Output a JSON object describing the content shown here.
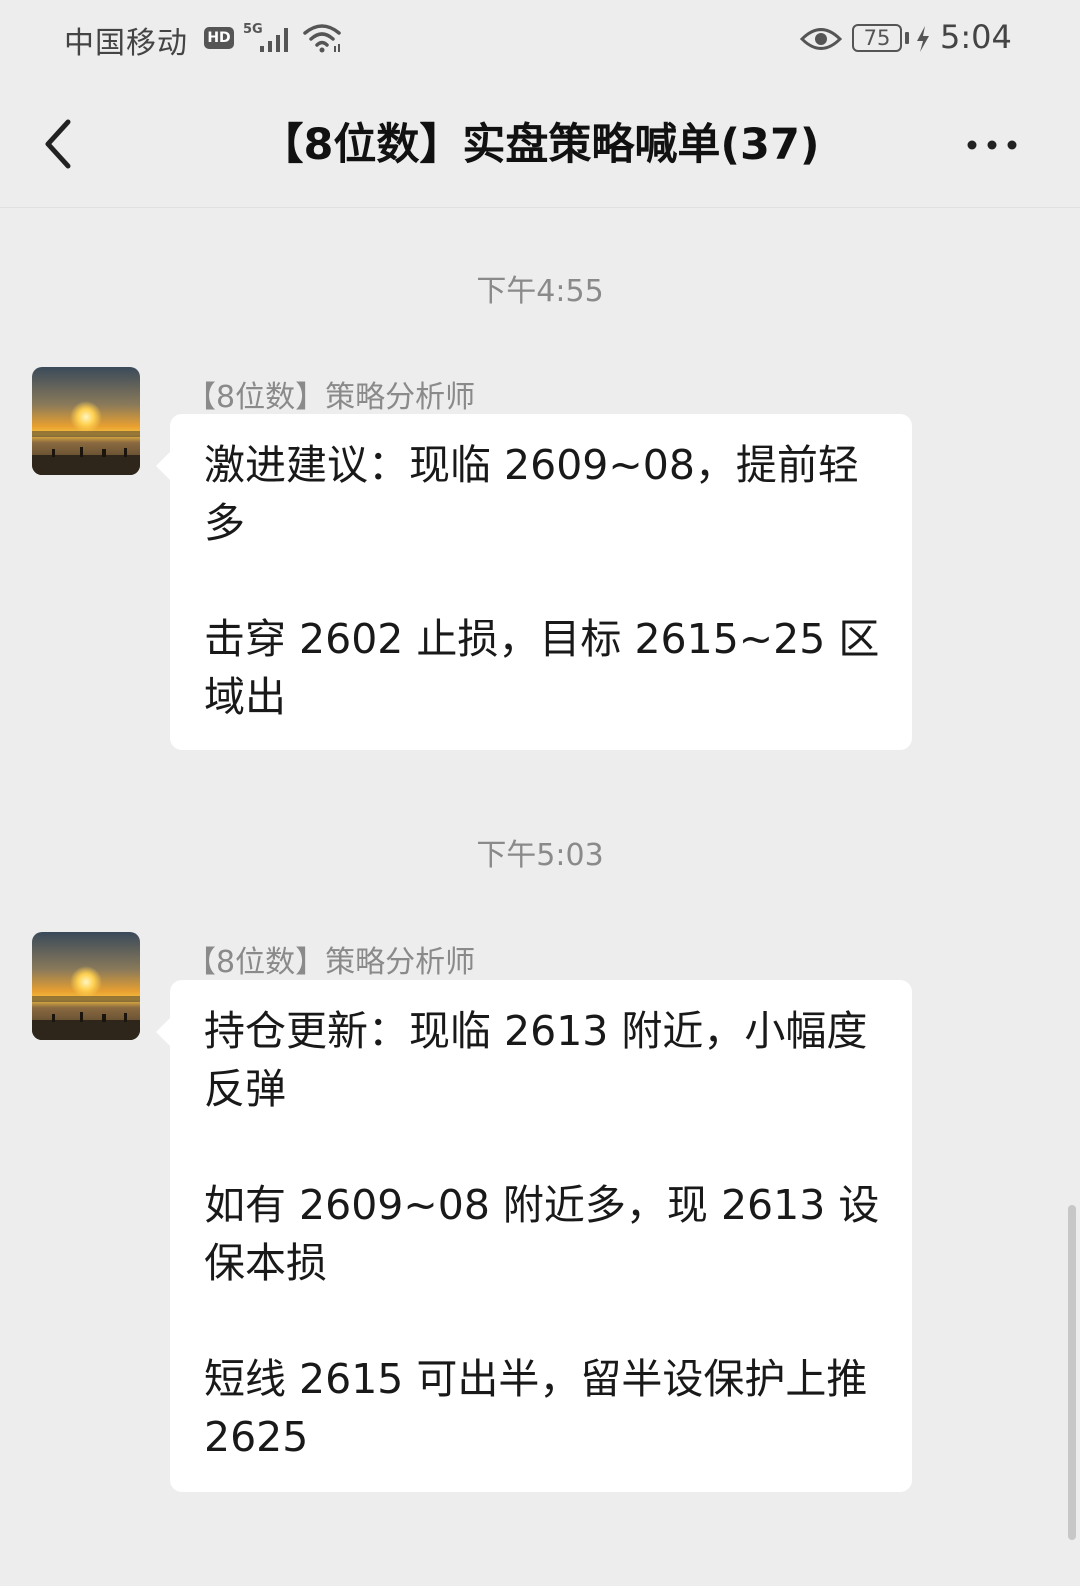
{
  "status_bar": {
    "carrier": "中国移动",
    "hd": "HD",
    "network": "5G",
    "battery": "75",
    "time": "5:04"
  },
  "nav": {
    "title": "【8位数】实盘策略喊单(37)"
  },
  "messages": [
    {
      "timestamp": "下午4:55",
      "sender": "【8位数】策略分析师",
      "paragraphs": [
        "激进建议：现临 2609~08，提前轻多",
        "击穿 2602 止损，目标 2615~25 区域出"
      ]
    },
    {
      "timestamp": "下午5:03",
      "sender": "【8位数】策略分析师",
      "paragraphs": [
        "持仓更新：现临 2613 附近，小幅度反弹",
        "如有 2609~08 附近多，现 2613 设保本损",
        "短线 2615 可出半，留半设保护上推 2625"
      ]
    }
  ],
  "icons": {
    "back": "chevron-left-icon",
    "more": "more-dots-icon",
    "avatar": "sunset-beach-avatar"
  },
  "colors": {
    "background": "#ededed",
    "bubble": "#ffffff",
    "meta_text": "#8a8a8a"
  }
}
